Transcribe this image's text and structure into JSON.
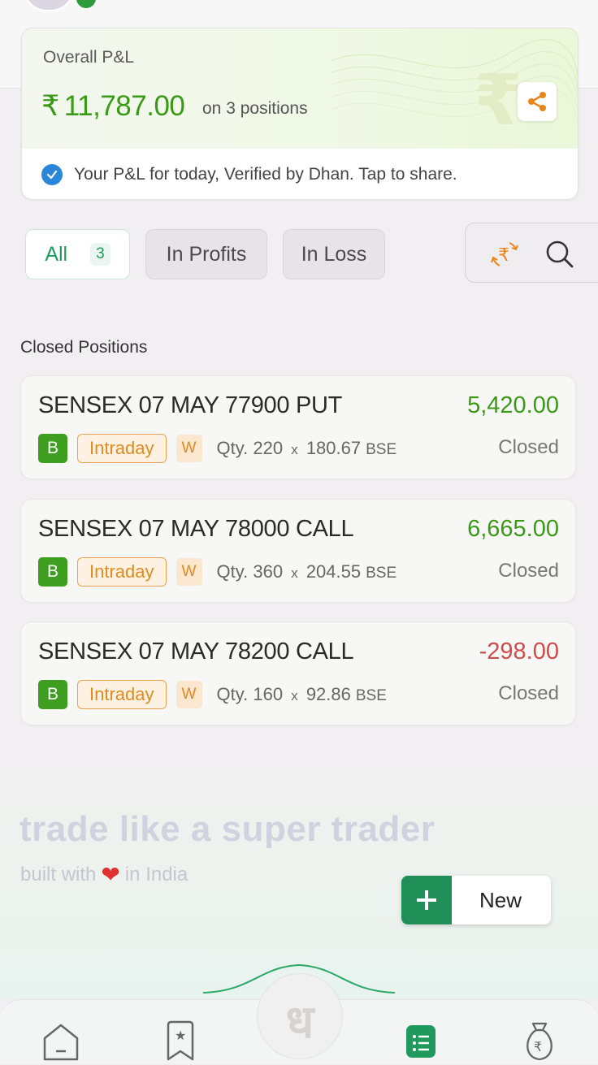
{
  "pnl": {
    "label": "Overall P&L",
    "currency": "₹",
    "value_int": "11,787",
    "value_dec": ".00",
    "positions_text": "on 3 positions",
    "verify_text": "Your P&L for today, Verified by Dhan. Tap to share."
  },
  "filters": {
    "all_label": "All",
    "all_count": "3",
    "profits_label": "In Profits",
    "loss_label": "In Loss"
  },
  "section_title": "Closed Positions",
  "positions": [
    {
      "name": "SENSEX 07 MAY 77900 PUT",
      "pnl": "5,420.00",
      "side": "B",
      "product": "Intraday",
      "tag": "W",
      "qty_label": "Qty.",
      "qty": "220",
      "x": "x",
      "price": "180.67",
      "exchange": "BSE",
      "status": "Closed"
    },
    {
      "name": "SENSEX 07 MAY 78000 CALL",
      "pnl": "6,665.00",
      "side": "B",
      "product": "Intraday",
      "tag": "W",
      "qty_label": "Qty.",
      "qty": "360",
      "x": "x",
      "price": "204.55",
      "exchange": "BSE",
      "status": "Closed"
    },
    {
      "name": "SENSEX 07 MAY 78200 CALL",
      "pnl": "-298.00",
      "side": "B",
      "product": "Intraday",
      "tag": "W",
      "qty_label": "Qty.",
      "qty": "160",
      "x": "x",
      "price": "92.86",
      "exchange": "BSE",
      "status": "Closed"
    }
  ],
  "promo": {
    "title": "trade like a super trader",
    "sub_before": "built with",
    "sub_after": "in India"
  },
  "new_button": {
    "label": "New"
  },
  "nav": {
    "center_glyph": "ध"
  },
  "colors": {
    "profit": "#3a9a16",
    "loss": "#d24b4b",
    "accent": "#1f8f57"
  }
}
